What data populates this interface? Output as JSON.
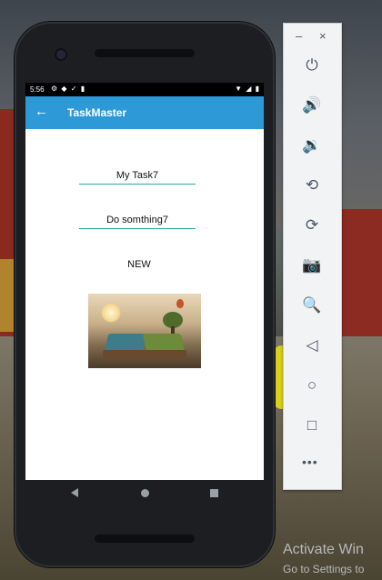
{
  "statusbar": {
    "time": "5:56",
    "left_icons": "⚙ ◆ ✓ ▮",
    "right_icons": "▼ ◢ ▮"
  },
  "appbar": {
    "back_icon": "arrow-back-icon",
    "title": "TaskMaster"
  },
  "form": {
    "title_value": "My Task7",
    "description_value": "Do somthing7",
    "status_label": "NEW"
  },
  "image": {
    "icon": "book-landscape-image"
  },
  "navbar": {
    "back": "nav-back-icon",
    "home": "nav-home-icon",
    "recents": "nav-recents-icon"
  },
  "emulator_toolbar": {
    "minimize": "–",
    "close": "×",
    "buttons": [
      {
        "name": "power-icon",
        "glyph": "⏻"
      },
      {
        "name": "volume-up-icon",
        "glyph": "🔊"
      },
      {
        "name": "volume-down-icon",
        "glyph": "🔉"
      },
      {
        "name": "rotate-left-icon",
        "glyph": "⟲"
      },
      {
        "name": "rotate-right-icon",
        "glyph": "⟳"
      },
      {
        "name": "camera-icon",
        "glyph": "📷"
      },
      {
        "name": "zoom-icon",
        "glyph": "🔍"
      },
      {
        "name": "back-icon",
        "glyph": "◁"
      },
      {
        "name": "home-icon",
        "glyph": "○"
      },
      {
        "name": "overview-icon",
        "glyph": "□"
      }
    ],
    "more": "•••"
  },
  "watermark": {
    "title": "Activate Win",
    "subtitle": "Go to Settings to"
  }
}
